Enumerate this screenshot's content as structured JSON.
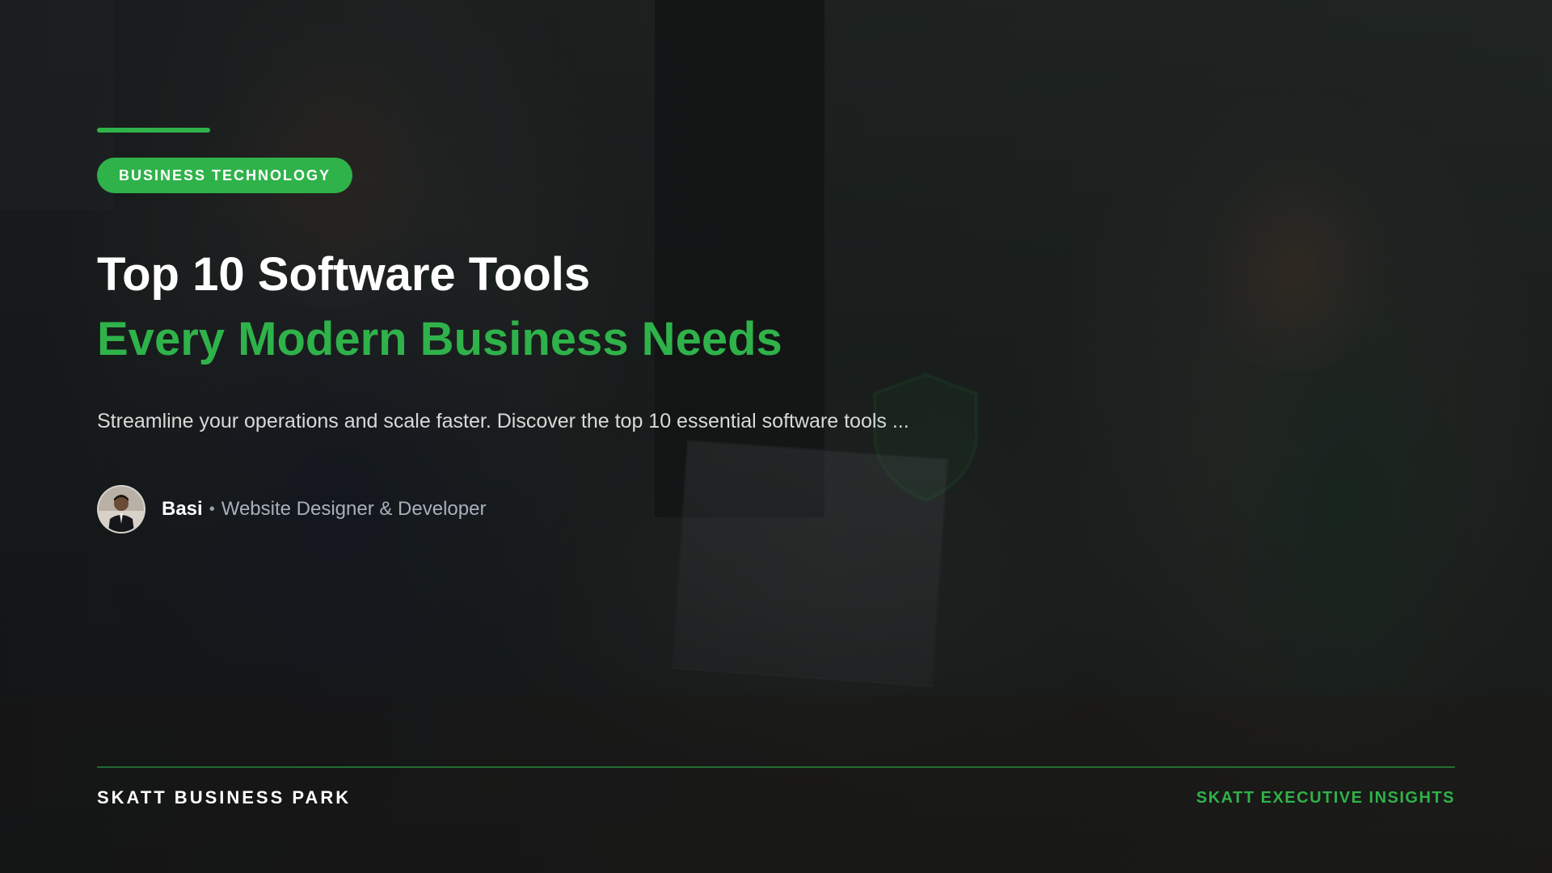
{
  "post": {
    "category": "BUSINESS TECHNOLOGY",
    "title_line1": "Top 10 Software Tools",
    "title_line2": "Every Modern Business Needs",
    "excerpt": "Streamline your operations and scale faster. Discover the top 10 essential software tools ..."
  },
  "author": {
    "name": "Basi",
    "separator": "•",
    "role": "Website Designer & Developer",
    "avatar_icon": "author-avatar"
  },
  "footer": {
    "left_label": "SKATT BUSINESS PARK",
    "right_label": "SKATT EXECUTIVE INSIGHTS"
  },
  "colors": {
    "accent": "#2fb24a",
    "title": "#ffffff",
    "excerpt": "#d7dad8",
    "role": "#a7b0ba"
  }
}
